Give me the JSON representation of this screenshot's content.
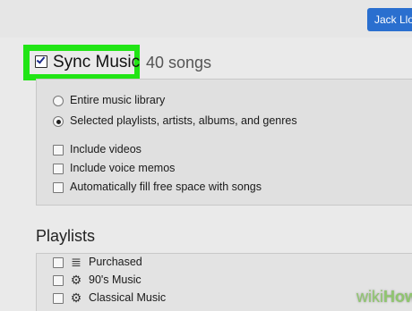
{
  "header": {
    "account_label": "Jack Llo"
  },
  "sync": {
    "label": "Sync Music",
    "count": "40 songs",
    "checked": true
  },
  "options": {
    "entire_library": "Entire music library",
    "selected_items": "Selected playlists, artists, albums, and genres",
    "include_videos": "Include videos",
    "include_voice_memos": "Include voice memos",
    "autofill": "Automatically fill free space with songs"
  },
  "playlists": {
    "heading": "Playlists",
    "items": [
      {
        "label": "Purchased",
        "icon": "playlist-icon"
      },
      {
        "label": "90's Music",
        "icon": "gear-icon"
      },
      {
        "label": "Classical Music",
        "icon": "gear-icon"
      }
    ]
  },
  "watermark": {
    "wiki": "wiki",
    "how": "How"
  },
  "colors": {
    "highlight": "#21e515",
    "account_button": "#2a6fcf"
  }
}
